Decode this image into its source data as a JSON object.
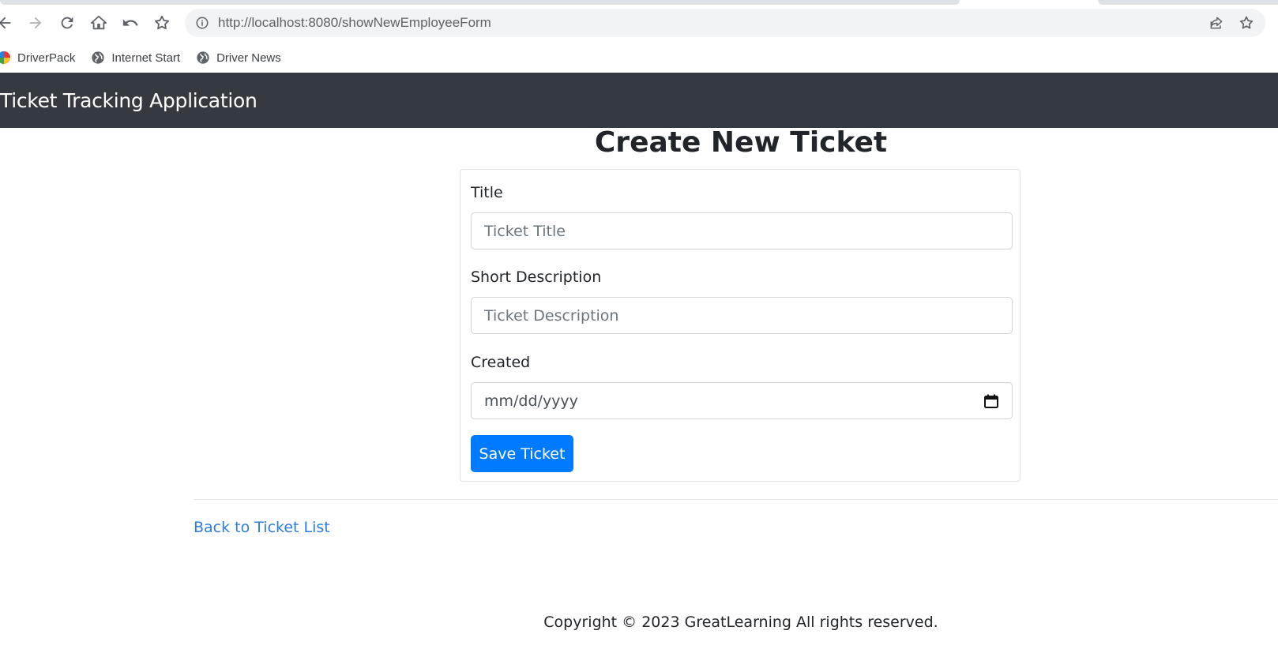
{
  "browser": {
    "url_host": "http://localhost",
    "url_rest": ":8080/showNewEmployeeForm",
    "bookmarks": [
      {
        "label": "DriverPack"
      },
      {
        "label": "Internet Start"
      },
      {
        "label": "Driver News"
      }
    ]
  },
  "navbar": {
    "brand": "Ticket Tracking Application"
  },
  "form": {
    "heading": "Create New Ticket",
    "title_label": "Title",
    "title_placeholder": "Ticket Title",
    "description_label": "Short Description",
    "description_placeholder": "Ticket Description",
    "created_label": "Created",
    "created_placeholder": "mm/dd/yyyy",
    "submit_label": "Save Ticket"
  },
  "links": {
    "back": "Back to Ticket List"
  },
  "footer": {
    "copyright": "Copyright © 2023 GreatLearning All rights reserved."
  },
  "colors": {
    "navbar_bg": "#343a40",
    "primary": "#007bff",
    "link": "#2a7de1"
  }
}
